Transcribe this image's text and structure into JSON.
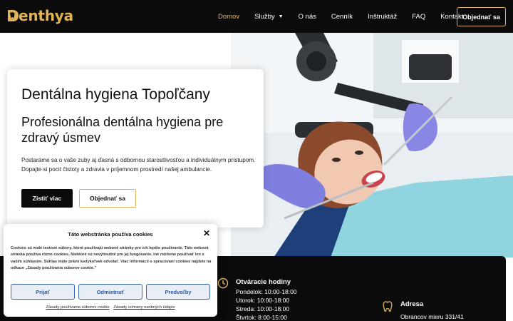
{
  "header": {
    "logo_text": "enthya",
    "nav": [
      {
        "label": "Domov",
        "active": true
      },
      {
        "label": "Služby",
        "dropdown": true
      },
      {
        "label": "O nás"
      },
      {
        "label": "Cenník"
      },
      {
        "label": "Inštruktáž"
      },
      {
        "label": "FAQ"
      },
      {
        "label": "Kontakt"
      }
    ],
    "cta_label": "Objednať sa"
  },
  "hero": {
    "title": "Dentálna hygiena Topoľčany",
    "subtitle": "Profesionálna dentálna hygiena pre zdravý úsmev",
    "text": "Postaráme sa o vaše zuby aj ďasná s odbornou starostlivosťou a individuálnym prístupom. Dopajte si pocit čistoty a zdravia v príjemnom prostredí našej ambulancie.",
    "primary_button": "Zistiť viac",
    "secondary_button": "Objednať sa"
  },
  "info": {
    "hours_title": "Otváracie hodiny",
    "hours": [
      "Pondelok: 10:00-18:00",
      "Utorok: 10:00-18:00",
      "Streda: 10:00-18:00",
      "Štvrtok: 8:00-15:00"
    ],
    "address_title": "Adresa",
    "address_line": "Obrancov mieru 331/41"
  },
  "cookie": {
    "title": "Táto webstránka používa cookies",
    "text": "Cookies sú malé textové súbory, ktoré používajú webové stránky pre ich lepšie používanie. Táto webová stránka používa rôzne cookies. Niektoré sú nevyhnutné pre jej fungovanie, iné môžeme používať len s vaším súhlasom. Súhlas máte právo kedykoľvek odvolať. Viac informácií o spracúvaní cookies nájdete na odkaze „Zásady používania súborov cookie.\"",
    "accept": "Prijať",
    "reject": "Odmietnuť",
    "preferences": "Predvoľby",
    "link_cookies": "Zásady používania súborov cookie",
    "link_privacy": "Zásady ochrany osobných údajov"
  },
  "colors": {
    "accent": "#e2b45a",
    "dark": "#0b0b0b",
    "cookie_button": "#2a5aa8"
  }
}
